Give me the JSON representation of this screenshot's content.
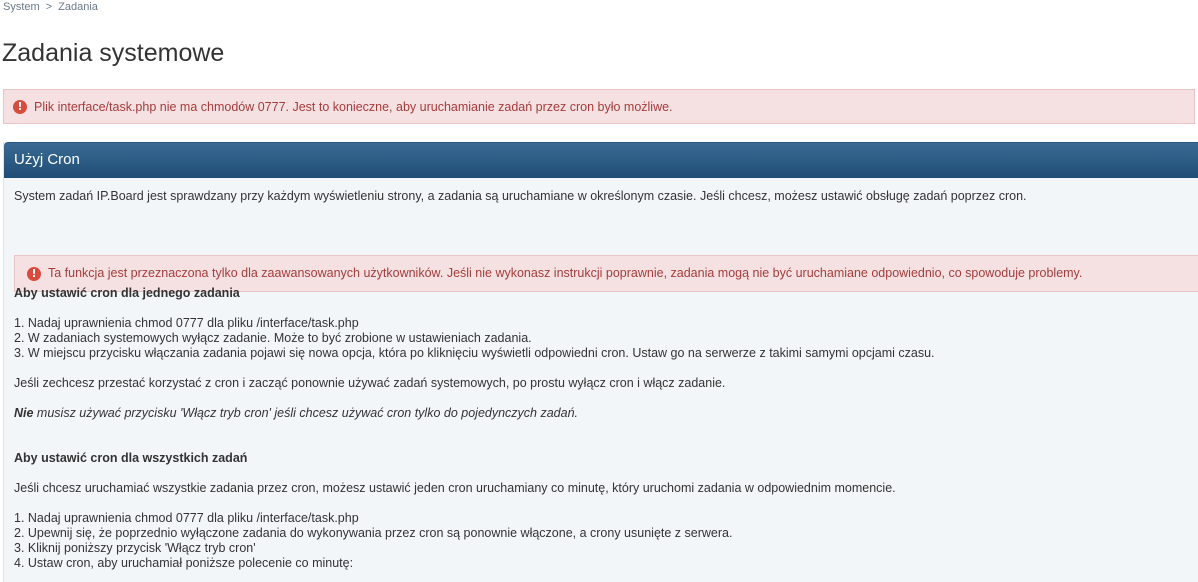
{
  "breadcrumb": {
    "items": [
      "System",
      "Zadania"
    ],
    "separator": ">"
  },
  "page": {
    "title": "Zadania systemowe"
  },
  "alerts": {
    "chmod_warning": "Plik interface/task.php nie ma chmodów 0777. Jest to konieczne, aby uruchamianie zadań przez cron było możliwe.",
    "advanced_warning": "Ta funkcja jest przeznaczona tylko dla zaawansowanych użytkowników. Jeśli nie wykonasz instrukcji poprawnie, zadania mogą nie być uruchamiane odpowiednio, co spowoduje problemy.",
    "icon": "exclamation-circle-icon"
  },
  "panel": {
    "title": "Użyj Cron",
    "intro": "System zadań IP.Board jest sprawdzany przy każdym wyświetleniu strony, a zadania są uruchamiane w określonym czasie. Jeśli chcesz, możesz ustawić obsługę zadań poprzez cron.",
    "single": {
      "heading": "Aby ustawić cron dla jednego zadania",
      "steps": [
        "1. Nadaj uprawnienia chmod 0777 dla pliku /interface/task.php",
        "2. W zadaniach systemowych wyłącz zadanie. Może to być zrobione w ustawieniach zadania.",
        "3. W miejscu przycisku włączania zadania pojawi się nowa opcja, która po kliknięciu wyświetli odpowiedni cron. Ustaw go na serwerze z takimi samymi opcjami czasu."
      ],
      "note": "Jeśli zechcesz przestać korzystać z cron i zacząć ponownie używać zadań systemowych, po prostu wyłącz cron i włącz zadanie.",
      "italic_bold": "Nie",
      "italic_rest": " musisz używać przycisku 'Włącz tryb cron' jeśli chcesz używać cron tylko do pojedynczych zadań."
    },
    "all": {
      "heading": "Aby ustawić cron dla wszystkich zadań",
      "intro": "Jeśli chcesz uruchamiać wszystkie zadania przez cron, możesz ustawić jeden cron uruchamiany co minutę, który uruchomi zadania w odpowiednim momencie.",
      "steps": [
        "1. Nadaj uprawnienia chmod 0777 dla pliku /interface/task.php",
        "2. Upewnij się, że poprzednio wyłączone zadania do wykonywania przez cron są ponownie włączone, a crony usunięte z serwera.",
        "3. Kliknij poniższy przycisk 'Włącz tryb cron'",
        "4. Ustaw cron, aby uruchamiał poniższe polecenie co minutę:"
      ]
    }
  }
}
